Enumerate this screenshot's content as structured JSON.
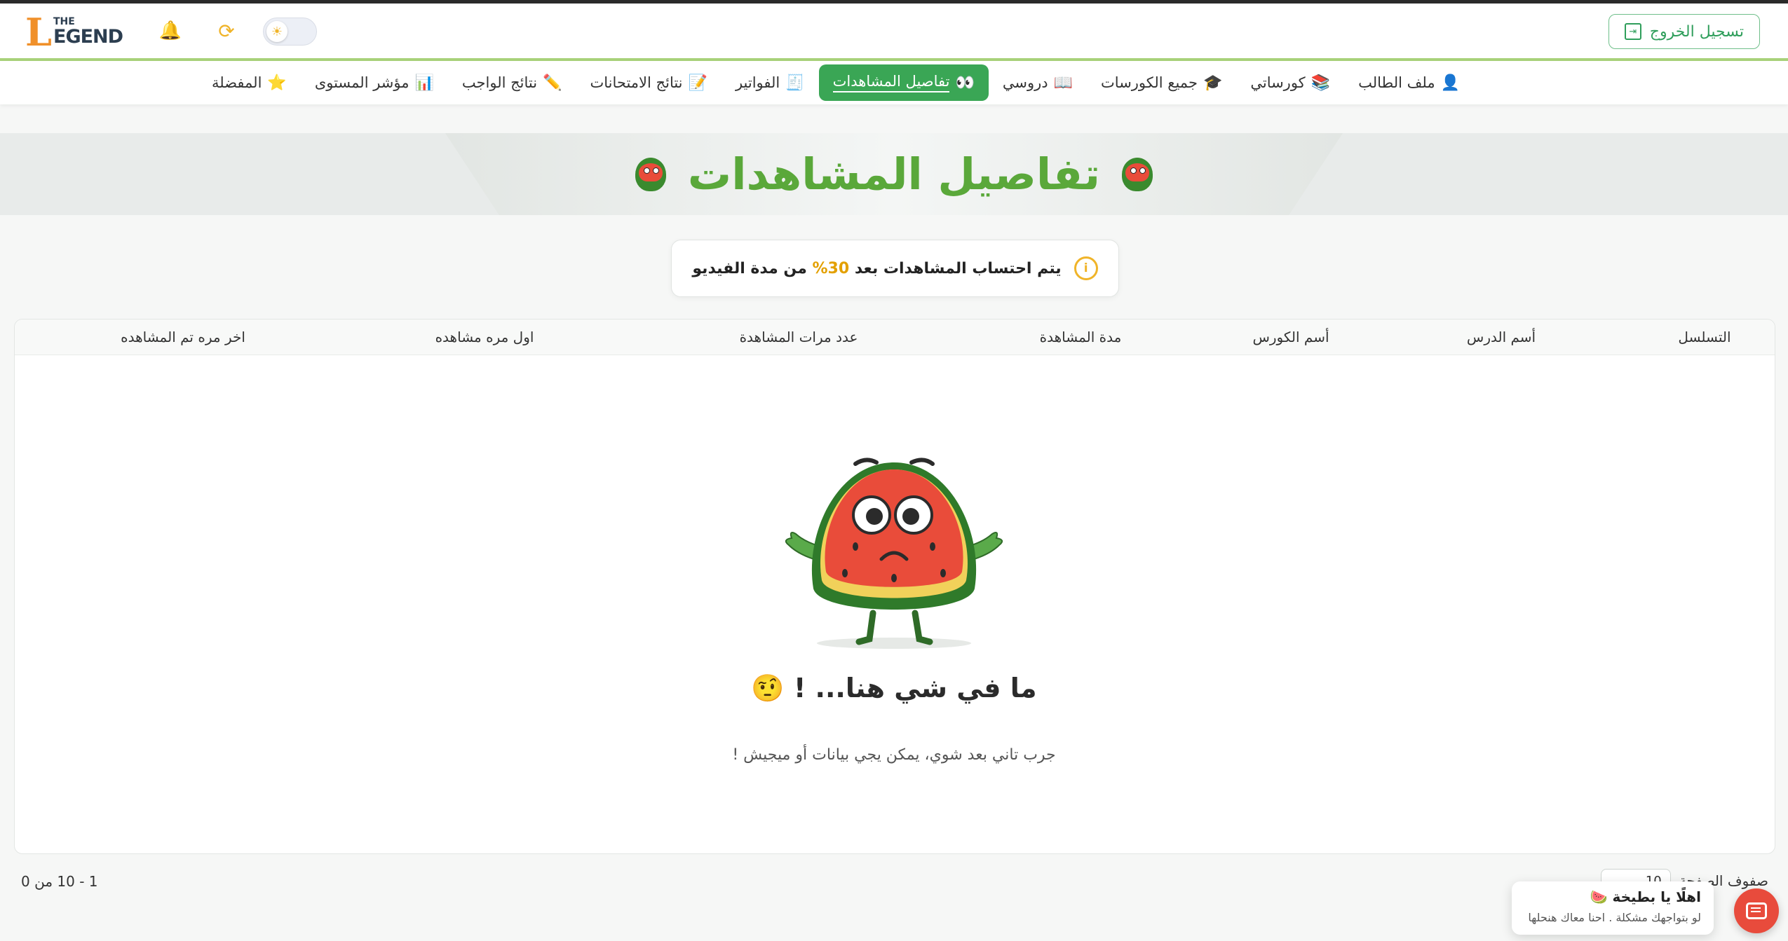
{
  "header": {
    "logo": {
      "main": "EGEND",
      "the": "THE",
      "big_letter": "L"
    },
    "logout_label": "تسجيل الخروج"
  },
  "nav": {
    "items": [
      {
        "label": "ملف الطالب",
        "emoji": "👤",
        "active": false
      },
      {
        "label": "كورساتي",
        "emoji": "📚",
        "active": false
      },
      {
        "label": "جميع الكورسات",
        "emoji": "🎓",
        "active": false
      },
      {
        "label": "دروسي",
        "emoji": "📖",
        "active": false
      },
      {
        "label": "تفاصيل المشاهدات",
        "emoji": "👀",
        "active": true
      },
      {
        "label": "الفواتير",
        "emoji": "🧾",
        "active": false
      },
      {
        "label": "نتائج الامتحانات",
        "emoji": "📝",
        "active": false
      },
      {
        "label": "نتائج الواجب",
        "emoji": "✏️",
        "active": false
      },
      {
        "label": "مؤشر المستوى",
        "emoji": "📊",
        "active": false
      },
      {
        "label": "المفضلة",
        "emoji": "⭐",
        "active": false
      }
    ]
  },
  "page": {
    "title": "تفاصيل المشاهدات",
    "info_before": "يتم احتساب المشاهدات بعد ",
    "info_pct": "30%",
    "info_after": " من مدة الفيديو"
  },
  "table": {
    "columns": [
      "التسلسل",
      "أسم الدرس",
      "أسم الكورس",
      "مدة المشاهدة",
      "عدد مرات المشاهدة",
      "اول مره مشاهده",
      "اخر مره تم المشاهده"
    ],
    "empty_title": "ما في شي هنا... !",
    "empty_emoji": "🤨",
    "empty_subtitle": "جرب تاني بعد شوي، يمكن يجي بيانات أو ميجيش !"
  },
  "pagination": {
    "range": "1 - 10 من 0",
    "rows_label": "صفوف الصفحة",
    "rows_value": "10"
  },
  "chat": {
    "greeting": "اهلًا يا بطيخة 🍉",
    "message": "لو بتواجهك مشكلة . احنا معاك هنحلها"
  },
  "colors": {
    "primary_green": "#3aa655",
    "title_green": "#5aa83a",
    "accent_yellow": "#f0b429",
    "chat_red": "#e84b3c"
  },
  "icons": {
    "bell": "bell-icon",
    "refresh": "refresh-icon",
    "theme": "sun-icon",
    "logout": "logout-icon",
    "info": "info-icon",
    "chat": "chat-icon"
  }
}
